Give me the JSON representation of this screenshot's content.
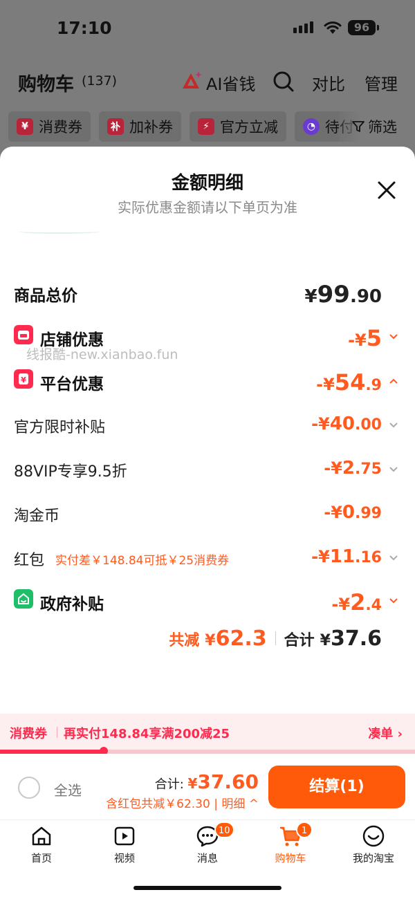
{
  "status": {
    "time": "17:10",
    "battery": "96"
  },
  "header": {
    "title": "购物车",
    "count": "(137)",
    "ai_label": "AI省钱",
    "compare": "对比",
    "manage": "管理"
  },
  "chips": [
    {
      "label": "消费券",
      "icon": "¥",
      "color": "#b8243a"
    },
    {
      "label": "加补券",
      "icon": "补",
      "color": "#b8243a"
    },
    {
      "label": "官方立减",
      "icon": "⚡",
      "color": "#b8243a"
    },
    {
      "label": "待付",
      "icon": "◔",
      "color": "#6a3bd0"
    }
  ],
  "filter_label": "筛选",
  "sheet": {
    "title": "金额明细",
    "subtitle": "实际优惠金额请以下单页为准",
    "watermark": "线报酷-new.xianbao.fun",
    "total_label": "商品总价",
    "total_sym": "¥",
    "total_int": "99",
    "total_dec": ".90",
    "shop": {
      "label": "店铺优惠",
      "prefix": "-¥",
      "int": "5",
      "dec": ""
    },
    "platform": {
      "label": "平台优惠",
      "prefix": "-¥",
      "int": "54",
      "dec": ".9"
    },
    "sub1": {
      "label": "官方限时补贴",
      "prefix": "-¥",
      "int": "40",
      "dec": ".00"
    },
    "sub2": {
      "label": "88VIP专享9.5折",
      "prefix": "-¥",
      "int": "2",
      "dec": ".75"
    },
    "sub3": {
      "label": "淘金币",
      "prefix": "-¥",
      "int": "0",
      "dec": ".99"
    },
    "sub4": {
      "label": "红包",
      "note": "实付差￥148.84可抵￥25消费券",
      "prefix": "-¥",
      "int": "11",
      "dec": ".16"
    },
    "gov": {
      "label": "政府补贴",
      "prefix": "-¥",
      "int": "2",
      "dec": ".4"
    },
    "summary": {
      "saved_label": "共减",
      "saved_sym": "¥",
      "saved_val": "62.3",
      "total_label": "合计",
      "total_sym": "¥",
      "total_val": "37.6"
    }
  },
  "coupon": {
    "label": "消费券",
    "text": "再实付148.84享满200减25",
    "more": "凑单 ›",
    "progress": 0.25
  },
  "checkout": {
    "select_all": "全选",
    "total_label": "合计: ",
    "total_sym": "¥",
    "total_val": "37.60",
    "detail": "含红包共减￥62.30 | 明细 ^",
    "pay": "结算(1)"
  },
  "tabs": [
    {
      "label": "首页",
      "icon": "home-icon"
    },
    {
      "label": "视频",
      "icon": "video-icon"
    },
    {
      "label": "消息",
      "icon": "message-icon",
      "badge": "10"
    },
    {
      "label": "购物车",
      "icon": "cart-icon",
      "badge": "1"
    },
    {
      "label": "我的淘宝",
      "icon": "profile-icon"
    }
  ],
  "colors": {
    "accent": "#ff5a1f",
    "coupon_red": "#ff2a4d",
    "pay_button": "#ff5a0a"
  }
}
